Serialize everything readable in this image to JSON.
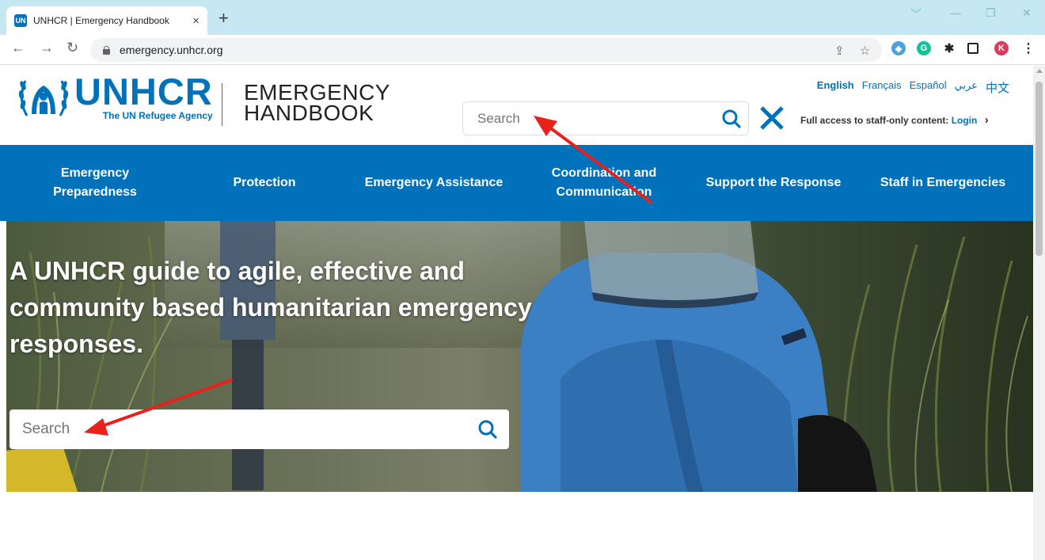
{
  "browser": {
    "tab_title": "UNHCR | Emergency Handbook",
    "favicon_text": "UN",
    "tab_close": "×",
    "new_tab": "+",
    "url": "emergency.unhcr.org",
    "profile_initial": "K",
    "window_controls": [
      "﹀",
      "—",
      "❐",
      "✕"
    ]
  },
  "header": {
    "logo_name": "UNHCR",
    "logo_tagline": "The UN Refugee Agency",
    "handbook_line1": "EMERGENCY",
    "handbook_line2": "HANDBOOK",
    "search_placeholder": "Search",
    "languages": [
      "English",
      "Français",
      "Español",
      "عربي",
      "中文"
    ],
    "access_text": "Full access to staff-only content:",
    "access_login": "Login",
    "access_chevron": "›"
  },
  "nav": {
    "items": [
      {
        "label": "Emergency Preparedness"
      },
      {
        "label": "Protection"
      },
      {
        "label": "Emergency Assistance"
      },
      {
        "label": "Coordination and Communication"
      },
      {
        "label": "Support the Response"
      },
      {
        "label": "Staff in Emergencies"
      }
    ]
  },
  "hero": {
    "title": "A UNHCR guide to agile, effective and community based humanitarian emergency responses.",
    "search_placeholder": "Search"
  },
  "colors": {
    "brand_blue": "#0072bc",
    "annotation_red": "#e8211d",
    "tabstrip_bg": "#c5e8f2"
  }
}
